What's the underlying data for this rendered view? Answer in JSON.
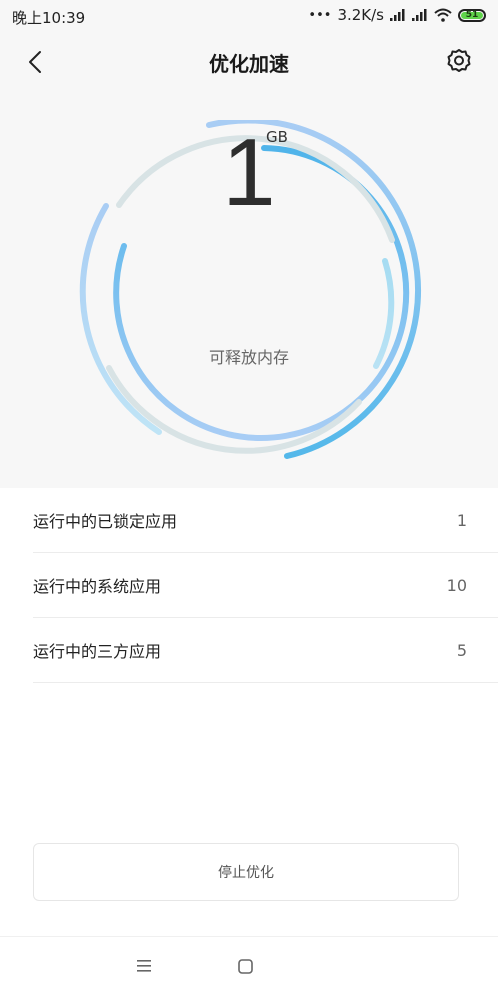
{
  "status_bar": {
    "time": "晚上10:39",
    "network_speed": "3.2K/s",
    "battery_level": "51",
    "icons": [
      "dots-icon",
      "signal-icon",
      "signal-icon",
      "wifi-icon",
      "battery-icon"
    ]
  },
  "header": {
    "title": "优化加速",
    "back_icon": "chevron-left-icon",
    "settings_icon": "gear-icon"
  },
  "memory": {
    "value": "1",
    "unit": "GB",
    "label": "可释放内存"
  },
  "list": {
    "items": [
      {
        "label": "运行中的已锁定应用",
        "count": "1"
      },
      {
        "label": "运行中的系统应用",
        "count": "10"
      },
      {
        "label": "运行中的三方应用",
        "count": "5"
      }
    ]
  },
  "actions": {
    "stop_label": "停止优化"
  },
  "nav_bar": {
    "icons": [
      "menu-icon",
      "home-icon"
    ]
  },
  "colors": {
    "gauge_blue": "#5bbbe9",
    "gauge_light_blue": "#a9d4f5",
    "gauge_gray": "#d5e0e2",
    "background_top": "#f7f7f7",
    "battery_green": "#5fd34a"
  }
}
